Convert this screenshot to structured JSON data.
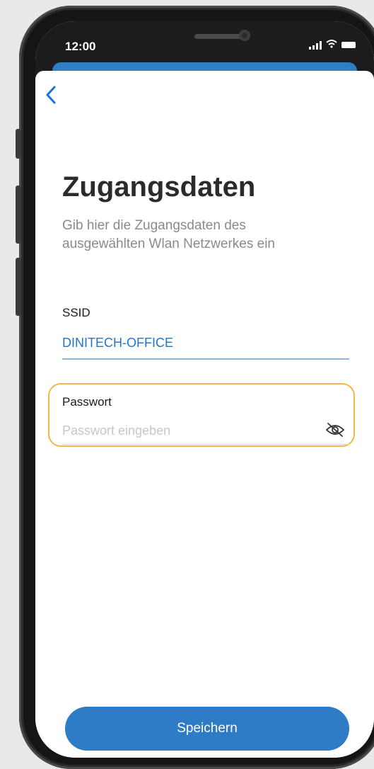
{
  "status_bar": {
    "time": "12:00"
  },
  "page": {
    "title": "Zugangsdaten",
    "subtitle": "Gib hier die Zugangsdaten des ausgewählten Wlan Netzwerkes ein"
  },
  "form": {
    "ssid_label": "SSID",
    "ssid_value": "DINITECH-OFFICE",
    "password_label": "Passwort",
    "password_placeholder": "Passwort eingeben",
    "password_value": ""
  },
  "actions": {
    "save_label": "Speichern"
  },
  "icons": {
    "back": "chevron-left-icon",
    "password_visibility": "eye-slash-icon",
    "signal": "cellular-signal-icon",
    "wifi": "wifi-icon",
    "battery": "battery-icon"
  },
  "colors": {
    "accent": "#2d7cc5",
    "link": "#2476c8",
    "highlight": "#f0b849",
    "subtitle": "#8a8a8a"
  }
}
